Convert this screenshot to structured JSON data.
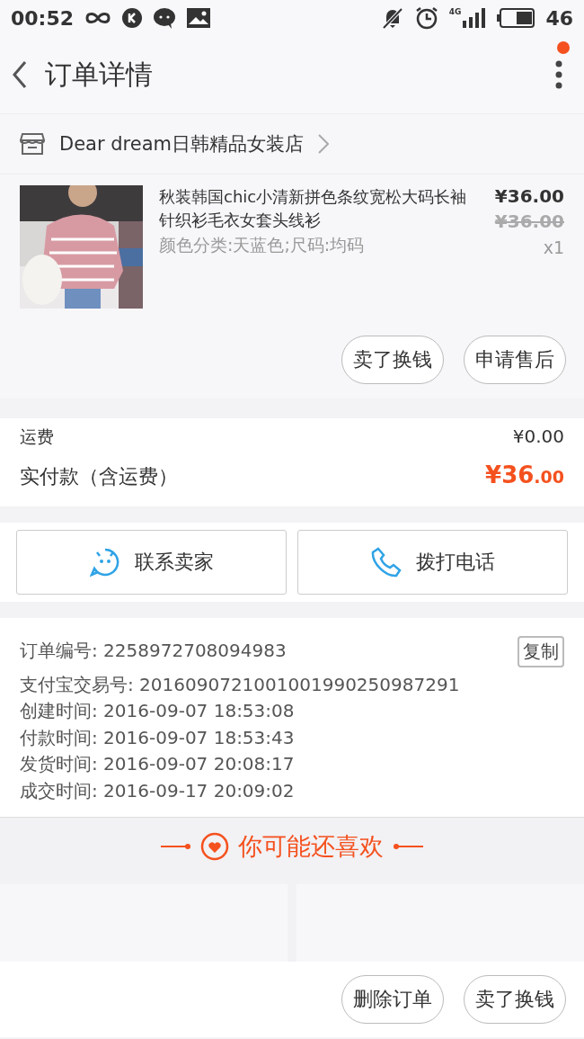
{
  "status_bar": {
    "time": "00:52",
    "network": "4G",
    "battery": "46"
  },
  "header": {
    "title": "订单详情",
    "has_notification": true
  },
  "shop": {
    "name": "Dear dream日韩精品女装店"
  },
  "product": {
    "kind": "picture",
    "title": "秋装韩国chic小清新拼色条纹宽松大码长袖针织衫毛衣女套头线衫",
    "sku": "颜色分类:天蓝色;尺码:均码",
    "price": "¥36.00",
    "original_price": "¥36.00",
    "quantity": "x1",
    "actions": [
      "卖了换钱",
      "申请售后"
    ]
  },
  "fees": [
    {
      "label": "运费",
      "value": "¥0.00",
      "kind": "plain"
    },
    {
      "label": "实付款（含运费）",
      "value": "¥36.00",
      "kind": "total"
    }
  ],
  "contact": [
    {
      "label": "联系卖家",
      "kind": "chat"
    },
    {
      "label": "拨打电话",
      "kind": "phone"
    }
  ],
  "order_info": {
    "copy_button": "复制",
    "lines": [
      "订单编号: 2258972708094983",
      "支付宝交易号: 2016090721001001990250987291",
      "创建时间: 2016-09-07 18:53:08",
      "付款时间: 2016-09-07 18:53:43",
      "发货时间: 2016-09-07 20:08:17",
      "成交时间: 2016-09-17 20:09:02"
    ]
  },
  "recommend": {
    "title": "你可能还喜欢"
  },
  "bottom_actions": [
    "删除订单",
    "卖了换钱"
  ]
}
